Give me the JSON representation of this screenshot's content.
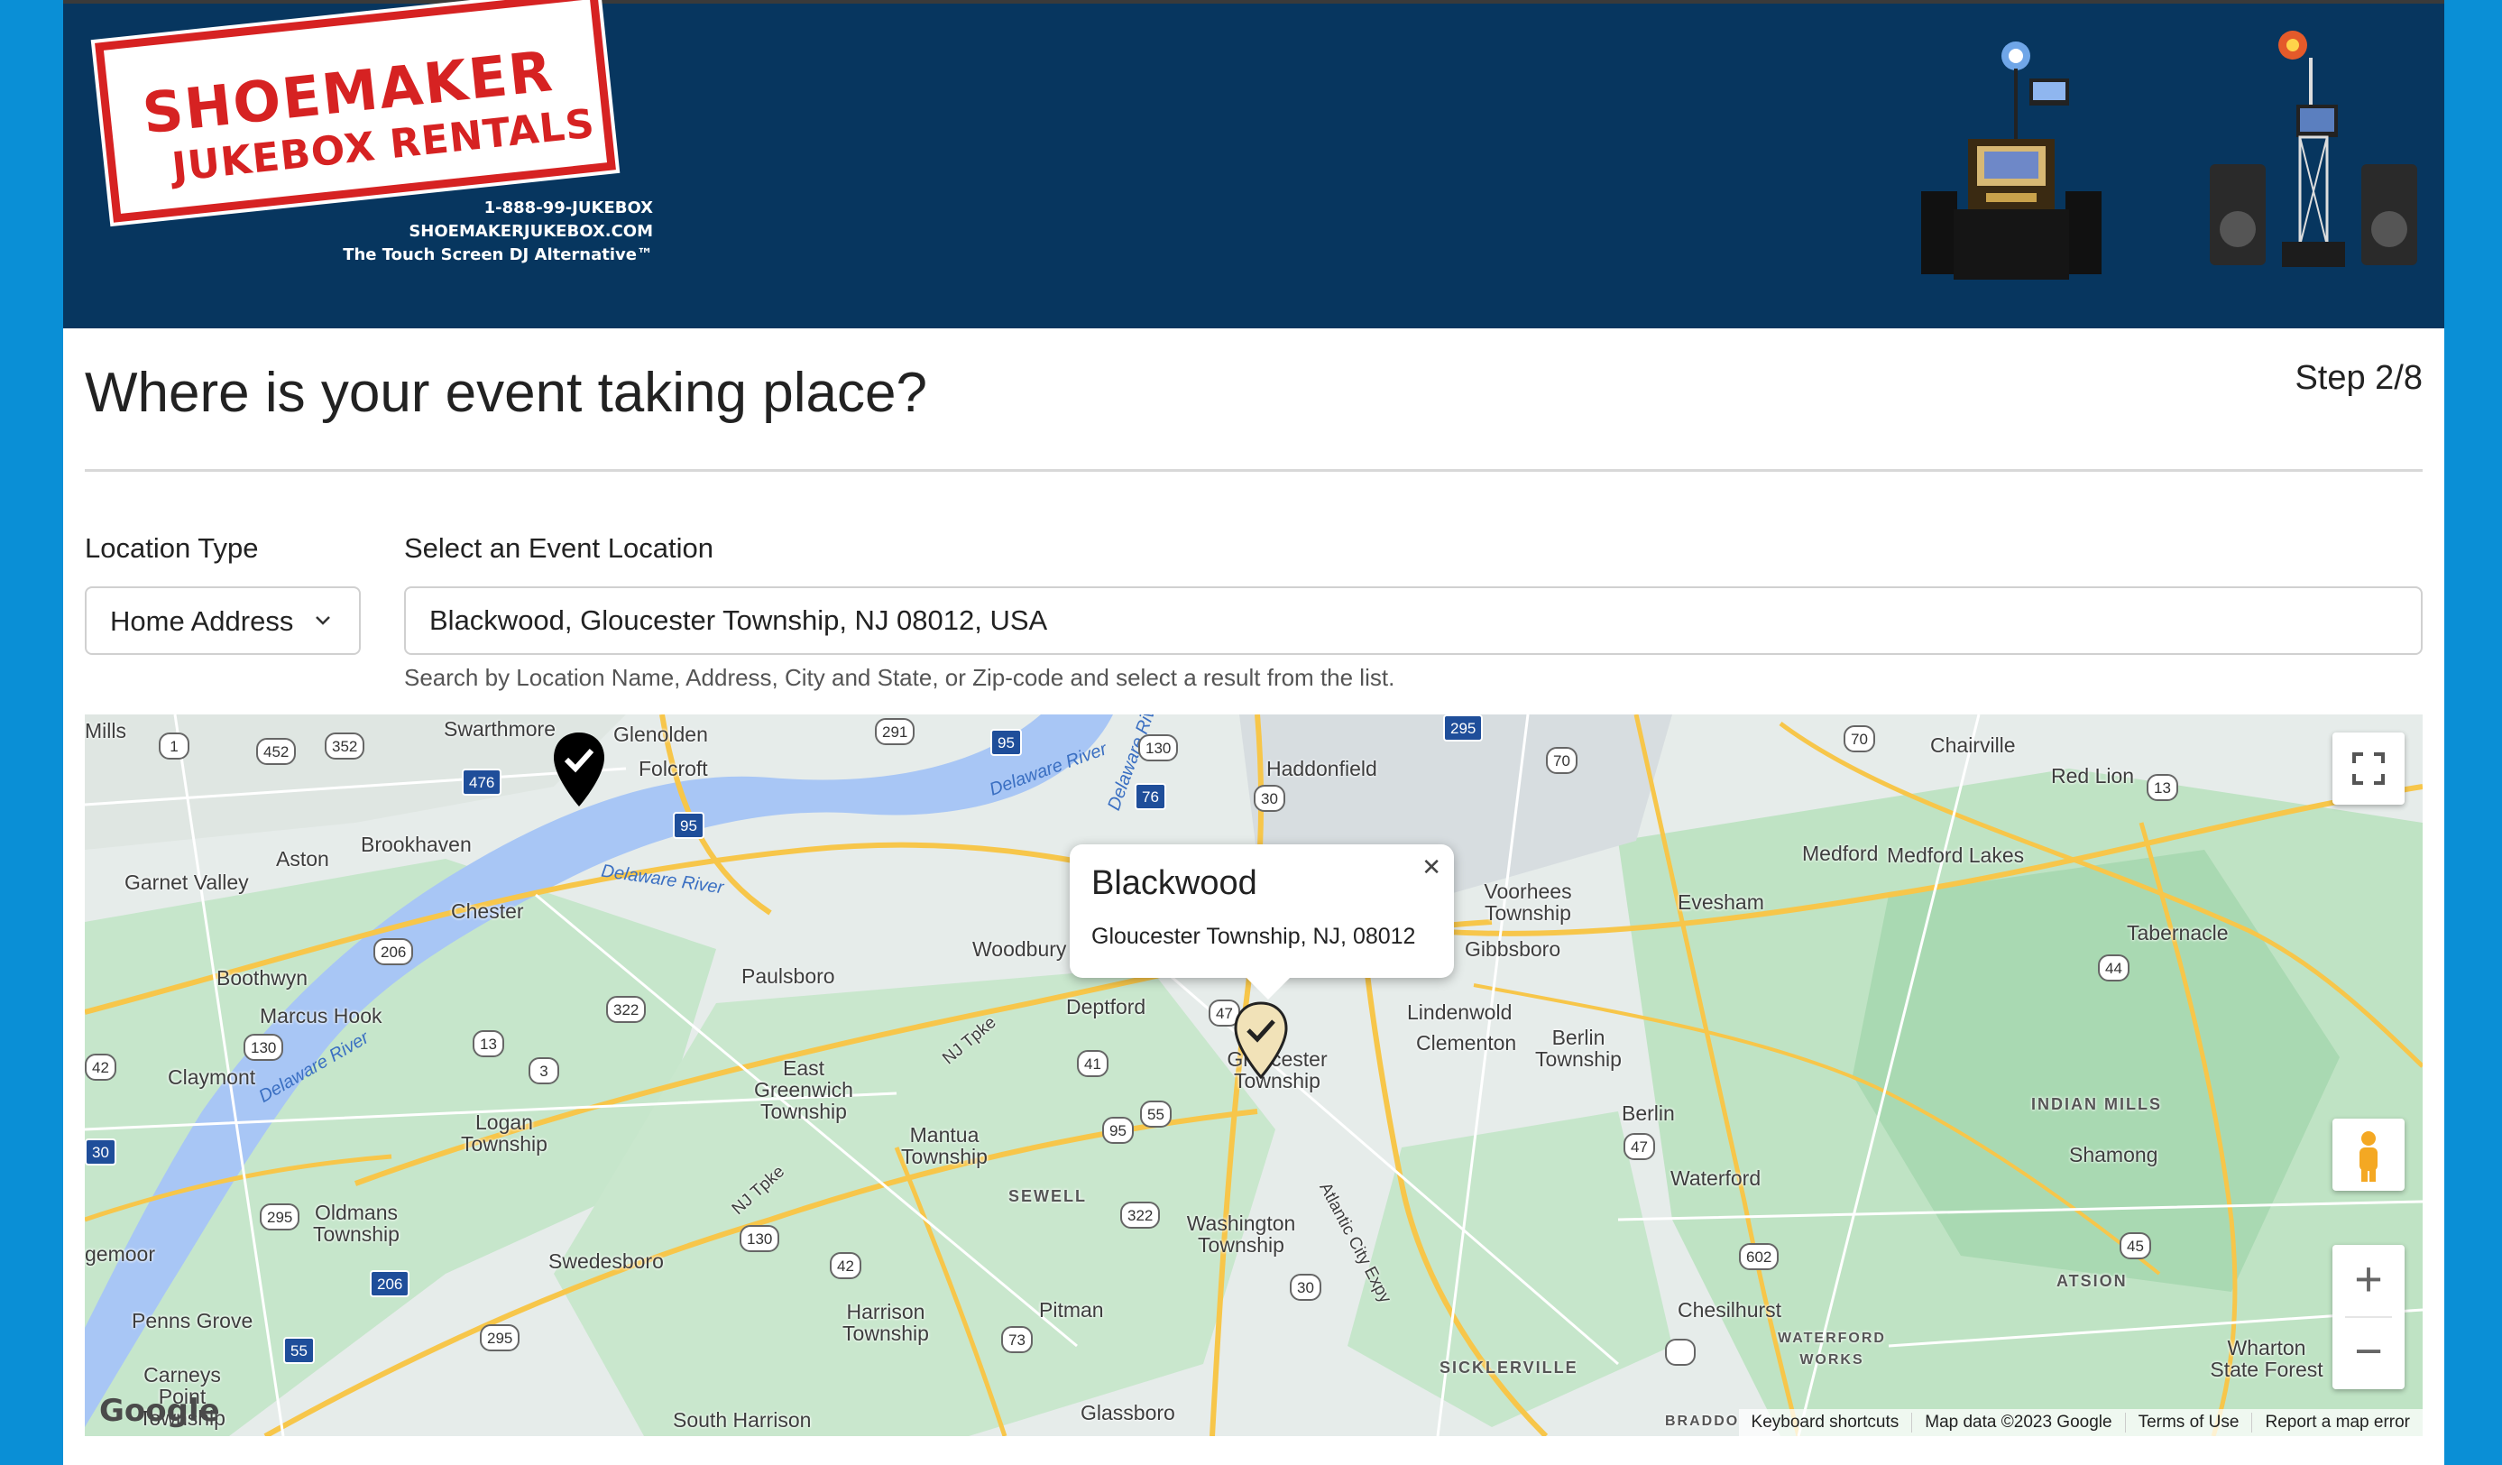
{
  "brand": {
    "line1": "SHOEMAKER",
    "line2": "JUKEBOX RENTALS",
    "phone": "1-888-99-JUKEBOX",
    "website": "SHOEMAKERJUKEBOX.COM",
    "tagline": "The Touch Screen DJ Alternative™",
    "colors": {
      "header": "#07365f",
      "accent": "#d62222",
      "side": "#0a8fd6"
    }
  },
  "page": {
    "title": "Where is your event taking place?",
    "step": "Step 2/8"
  },
  "form": {
    "location_type_label": "Location Type",
    "location_type_value": "Home Address",
    "event_location_label": "Select an Event Location",
    "event_location_value": "Blackwood, Gloucester Township, NJ 08012, USA",
    "hint": "Search by Location Name, Address, City and State, or Zip-code and select a result from the list."
  },
  "map": {
    "popup_title": "Blackwood",
    "popup_subtitle": "Gloucester Township, NJ, 08012",
    "places": [
      "Mills",
      "Swarthmore",
      "Glenolden",
      "Folcroft",
      "Haddonfield",
      "Chairville",
      "Red Lion",
      "Aston",
      "Brookhaven",
      "Garnet Valley",
      "Chester",
      "Medford",
      "Medford Lakes",
      "Voorhees Township",
      "Evesham",
      "Gibbsboro",
      "Tabernacle",
      "Boothwyn",
      "Marcus Hook",
      "Paulsboro",
      "Woodbury",
      "Deptford",
      "Lindenwold",
      "Clementon",
      "Berlin Township",
      "Gloucester Township",
      "Claymont",
      "East Greenwich Township",
      "Logan Township",
      "Mantua Township",
      "Berlin",
      "INDIAN MILLS",
      "Shamong",
      "Waterford",
      "SEWELL",
      "Washington Township",
      "Oldmans Township",
      "gemoor",
      "Swedesboro",
      "ATSION",
      "Penns Grove",
      "Harrison Township",
      "Pitman",
      "Chesilhurst",
      "WATERFORD WORKS",
      "Wharton State Forest",
      "Carneys Point Township",
      "SICKLERVILLE",
      "South Harrison",
      "Glassboro",
      "BRADDO"
    ],
    "water": [
      "Delaware River",
      "Delaware River",
      "Delaware River",
      "Delaware River"
    ],
    "roads": [
      "1",
      "452",
      "352",
      "291",
      "95",
      "130",
      "295",
      "70",
      "476",
      "95",
      "76",
      "30",
      "70",
      "13",
      "206",
      "44",
      "322",
      "13",
      "130",
      "3",
      "42",
      "47",
      "41",
      "55",
      "95",
      "30",
      "47",
      "322",
      "130",
      "295",
      "206",
      "45",
      "42",
      "30",
      "602",
      "295",
      "55",
      "73"
    ],
    "road_labels": [
      "NJ Tpke",
      "NJ Tpke",
      "Atlantic City Expy"
    ],
    "google": "Google",
    "attribution": [
      "Keyboard shortcuts",
      "Map data ©2023 Google",
      "Terms of Use",
      "Report a map error"
    ],
    "controls": {
      "fullscreen": "fullscreen-icon",
      "pegman": "pegman-icon",
      "zoom_in": "+",
      "zoom_out": "−"
    },
    "colors": {
      "land": "#e6ecea",
      "park": "#bfe3c4",
      "water": "#a8c6f5",
      "highway": "#f7c64a"
    }
  }
}
